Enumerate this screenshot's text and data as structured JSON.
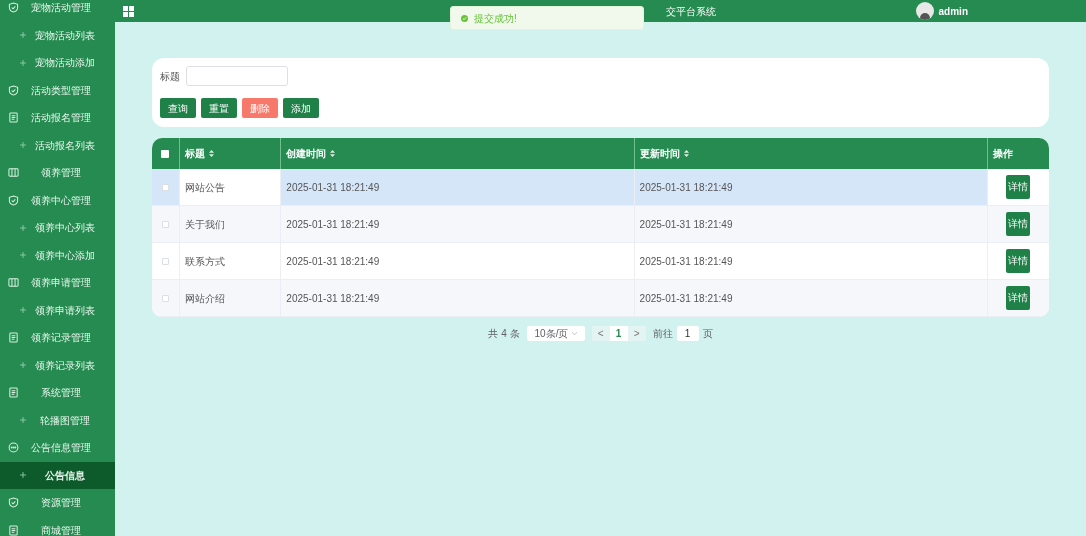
{
  "sidebar": {
    "items": [
      {
        "kind": "shield",
        "label": "宠物活动管理",
        "selected": false
      },
      {
        "kind": "child",
        "label": "宠物活动列表",
        "selected": false
      },
      {
        "kind": "child",
        "label": "宠物活动添加",
        "selected": false
      },
      {
        "kind": "shield",
        "label": "活动类型管理",
        "selected": false
      },
      {
        "kind": "doc",
        "label": "活动报名管理",
        "selected": false
      },
      {
        "kind": "child",
        "label": "活动报名列表",
        "selected": false
      },
      {
        "kind": "columns",
        "label": "领养管理",
        "selected": false
      },
      {
        "kind": "shield",
        "label": "领养中心管理",
        "selected": false
      },
      {
        "kind": "child",
        "label": "领养中心列表",
        "selected": false
      },
      {
        "kind": "child",
        "label": "领养中心添加",
        "selected": false
      },
      {
        "kind": "columns",
        "label": "领养申请管理",
        "selected": false
      },
      {
        "kind": "child",
        "label": "领养申请列表",
        "selected": false
      },
      {
        "kind": "doc",
        "label": "领养记录管理",
        "selected": false
      },
      {
        "kind": "child",
        "label": "领养记录列表",
        "selected": false
      },
      {
        "kind": "doc",
        "label": "系统管理",
        "selected": false
      },
      {
        "kind": "child",
        "label": "轮播图管理",
        "selected": false
      },
      {
        "kind": "chat",
        "label": "公告信息管理",
        "selected": false
      },
      {
        "kind": "child",
        "label": "公告信息",
        "selected": true
      },
      {
        "kind": "shield",
        "label": "资源管理",
        "selected": false
      },
      {
        "kind": "doc",
        "label": "商城管理",
        "selected": false
      }
    ]
  },
  "header": {
    "title": "交平台系统",
    "user": "admin"
  },
  "toast": {
    "message": "提交成功!"
  },
  "search": {
    "label": "标题",
    "buttons": [
      {
        "label": "查询",
        "kind": "primary"
      },
      {
        "label": "重置",
        "kind": "primary"
      },
      {
        "label": "删除",
        "kind": "danger"
      },
      {
        "label": "添加",
        "kind": "primary"
      }
    ]
  },
  "table": {
    "all_checked": false,
    "columns": [
      {
        "label": "标题",
        "sortable": true
      },
      {
        "label": "创建时间",
        "sortable": true
      },
      {
        "label": "更新时间",
        "sortable": true
      },
      {
        "label": "操作",
        "sortable": false
      }
    ],
    "rows": [
      {
        "title": "网站公告",
        "created": "2025-01-31 18:21:49",
        "updated": "2025-01-31 18:21:49",
        "action": "详情",
        "checked": false,
        "highlighted": true
      },
      {
        "title": "关于我们",
        "created": "2025-01-31 18:21:49",
        "updated": "2025-01-31 18:21:49",
        "action": "详情",
        "checked": false,
        "highlighted": false
      },
      {
        "title": "联系方式",
        "created": "2025-01-31 18:21:49",
        "updated": "2025-01-31 18:21:49",
        "action": "详情",
        "checked": false,
        "highlighted": false
      },
      {
        "title": "网站介绍",
        "created": "2025-01-31 18:21:49",
        "updated": "2025-01-31 18:21:49",
        "action": "详情",
        "checked": false,
        "highlighted": false
      }
    ]
  },
  "pagination": {
    "total": "共 4 条",
    "page_size": "10条/页",
    "prev": "<",
    "page": "1",
    "next": ">",
    "goto_label": "前往",
    "goto_value": "1",
    "goto_suffix": "页"
  }
}
